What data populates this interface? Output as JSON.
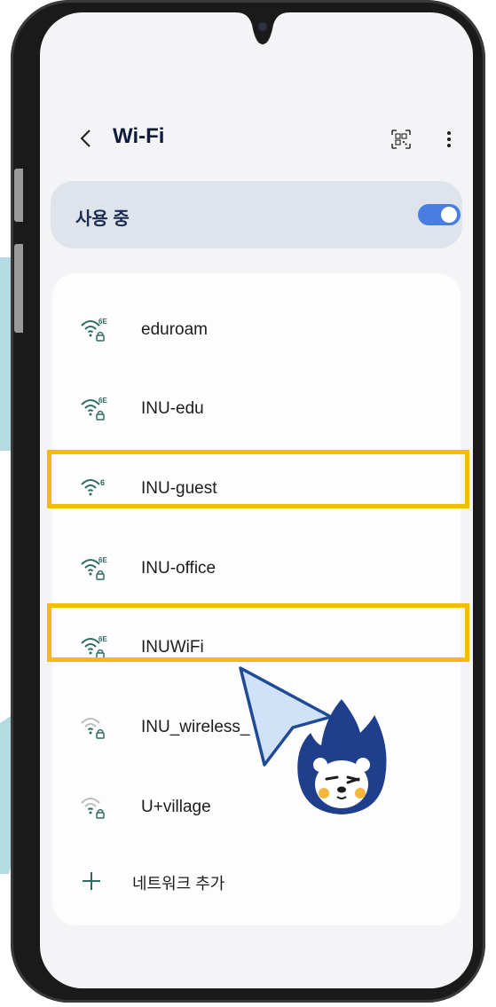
{
  "status_bar": {},
  "header": {
    "title": "Wi-Fi",
    "back_icon": "chevron-left-icon",
    "qr_icon": "qr-scan-icon",
    "more_icon": "more-vertical-icon"
  },
  "wifi_toggle": {
    "label": "사용 중",
    "state": "on",
    "accent": "#4a7de0"
  },
  "networks": [
    {
      "name": "eduroam",
      "badge": "6E",
      "secured": true,
      "signal": "strong",
      "highlighted": false
    },
    {
      "name": "INU-edu",
      "badge": "6E",
      "secured": true,
      "signal": "strong",
      "highlighted": false
    },
    {
      "name": "INU-guest",
      "badge": "6",
      "secured": false,
      "signal": "strong",
      "highlighted": true
    },
    {
      "name": "INU-office",
      "badge": "6E",
      "secured": true,
      "signal": "strong",
      "highlighted": false
    },
    {
      "name": "INUWiFi",
      "badge": "6E",
      "secured": true,
      "signal": "strong",
      "highlighted": true
    },
    {
      "name": "INU_wireless_",
      "badge": "",
      "secured": true,
      "signal": "weak",
      "highlighted": false
    },
    {
      "name": "U+village",
      "badge": "",
      "secured": true,
      "signal": "weak",
      "highlighted": false
    }
  ],
  "add_network": {
    "label": "네트워크 추가",
    "icon": "plus-icon"
  },
  "highlight_color": "#f5bc05"
}
